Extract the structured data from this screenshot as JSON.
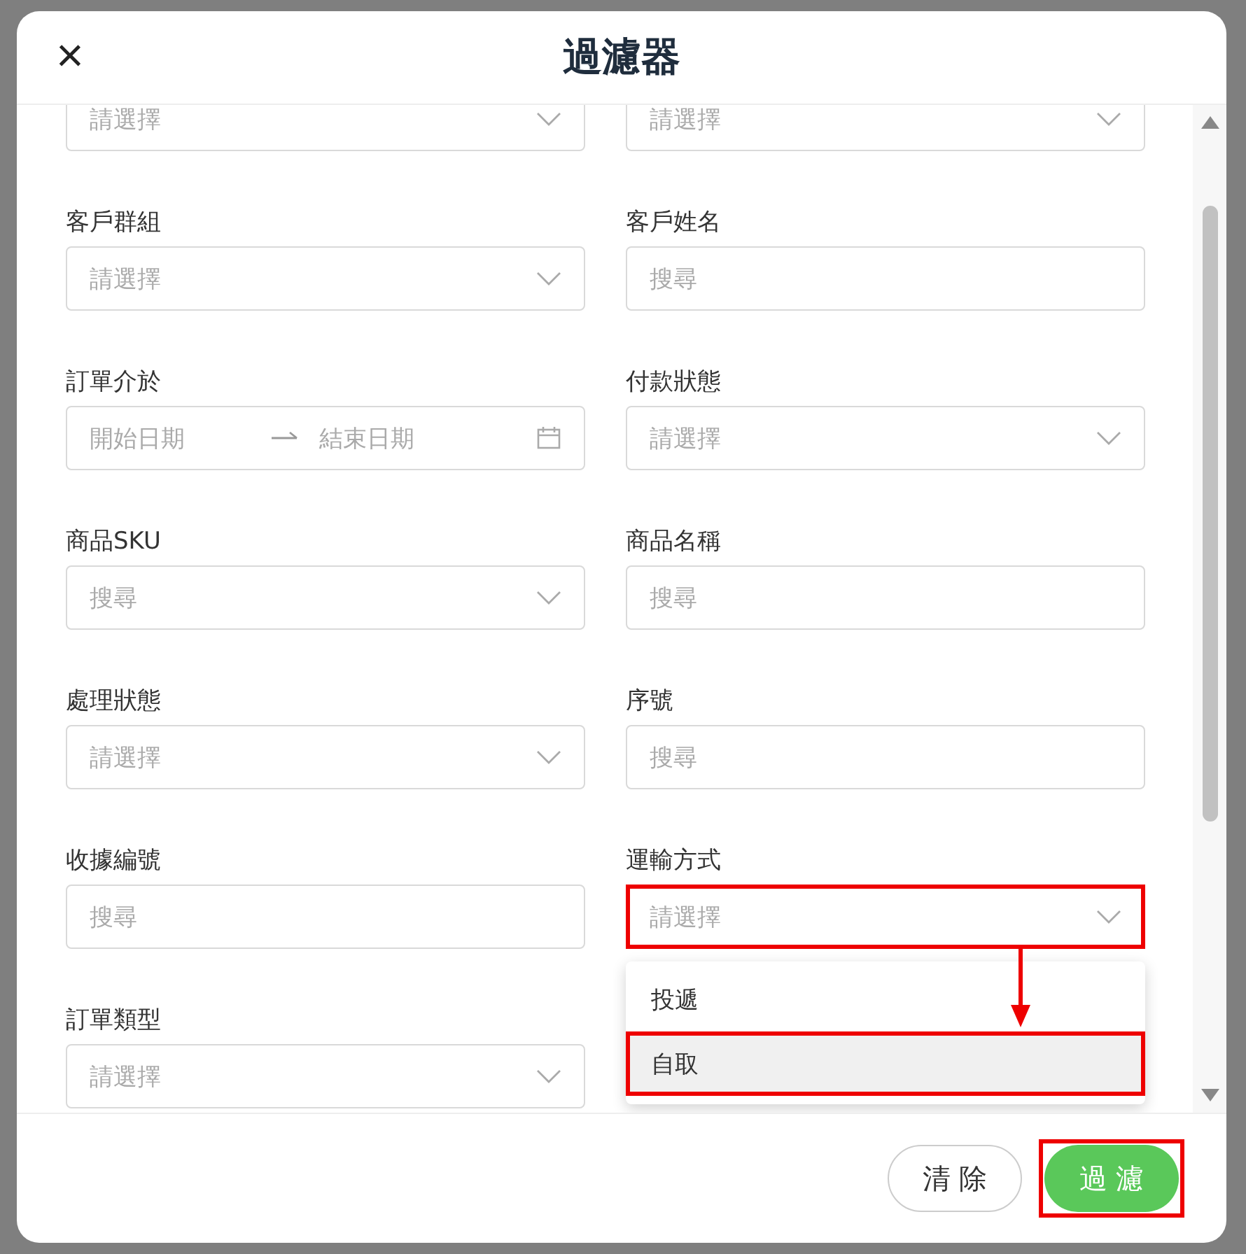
{
  "dialog": {
    "title": "過濾器",
    "close": "×"
  },
  "rows": [
    [
      {
        "kind": "select",
        "placeholder": "請選擇"
      },
      {
        "kind": "select",
        "placeholder": "請選擇"
      }
    ],
    [
      {
        "label": "客戶群組",
        "kind": "select",
        "placeholder": "請選擇"
      },
      {
        "label": "客戶姓名",
        "kind": "search",
        "placeholder": "搜尋"
      }
    ],
    [
      {
        "label": "訂單介於",
        "kind": "date_range",
        "placeholder": "開始日期",
        "placeholder_end": "結束日期"
      },
      {
        "label": "付款狀態",
        "kind": "select",
        "placeholder": "請選擇"
      }
    ],
    [
      {
        "label": "商品SKU",
        "kind": "select",
        "placeholder": "搜尋"
      },
      {
        "label": "商品名稱",
        "kind": "search",
        "placeholder": "搜尋"
      }
    ],
    [
      {
        "label": "處理狀態",
        "kind": "select",
        "placeholder": "請選擇"
      },
      {
        "label": "序號",
        "kind": "search",
        "placeholder": "搜尋"
      }
    ],
    [
      {
        "label": "收據編號",
        "kind": "search",
        "placeholder": "搜尋"
      },
      {
        "label": "運輸方式",
        "kind": "select",
        "placeholder": "請選擇",
        "highlighted": true,
        "expanded": true,
        "options": [
          {
            "label": "投遞",
            "selected": false,
            "highlighted": false
          },
          {
            "label": "自取",
            "selected": true,
            "highlighted": true
          }
        ]
      }
    ],
    [
      {
        "label": "訂單類型",
        "kind": "select",
        "placeholder": "請選擇"
      }
    ]
  ],
  "buttons": [
    {
      "label": "清 除",
      "kind": "secondary"
    },
    {
      "label": "過 濾",
      "kind": "primary",
      "highlighted": true
    }
  ]
}
